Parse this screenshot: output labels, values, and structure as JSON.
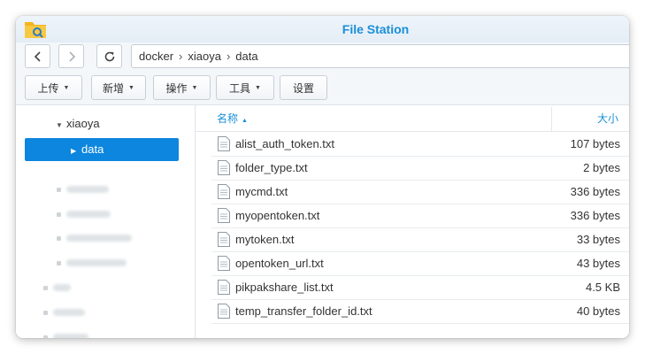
{
  "window": {
    "title": "File Station"
  },
  "breadcrumb": [
    "docker",
    "xiaoya",
    "data"
  ],
  "toolbar": {
    "upload": "上传",
    "new": "新增",
    "action": "操作",
    "tools": "工具",
    "settings": "设置"
  },
  "tree": {
    "parent": "xiaoya",
    "selected": "data"
  },
  "list": {
    "col_name": "名称",
    "col_size": "大小",
    "files": [
      {
        "name": "alist_auth_token.txt",
        "size": "107 bytes"
      },
      {
        "name": "folder_type.txt",
        "size": "2 bytes"
      },
      {
        "name": "mycmd.txt",
        "size": "336 bytes"
      },
      {
        "name": "myopentoken.txt",
        "size": "336 bytes"
      },
      {
        "name": "mytoken.txt",
        "size": "33 bytes"
      },
      {
        "name": "opentoken_url.txt",
        "size": "43 bytes"
      },
      {
        "name": "pikpakshare_list.txt",
        "size": "4.5 KB"
      },
      {
        "name": "temp_transfer_folder_id.txt",
        "size": "40 bytes"
      }
    ]
  },
  "colors": {
    "accent": "#0c86de",
    "title": "#1a8fd8"
  }
}
